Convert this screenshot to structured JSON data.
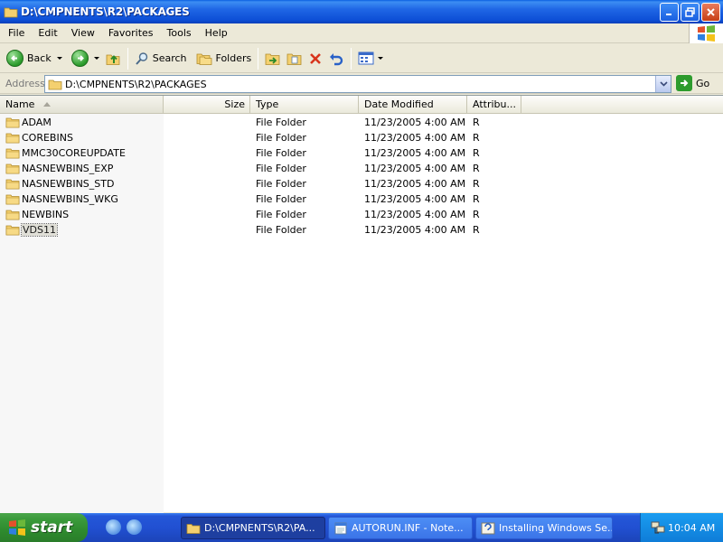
{
  "window": {
    "title": "D:\\CMPNENTS\\R2\\PACKAGES"
  },
  "menu": [
    {
      "label": "File"
    },
    {
      "label": "Edit"
    },
    {
      "label": "View"
    },
    {
      "label": "Favorites"
    },
    {
      "label": "Tools"
    },
    {
      "label": "Help"
    }
  ],
  "toolbar": {
    "back_label": "Back",
    "search_label": "Search",
    "folders_label": "Folders"
  },
  "address": {
    "label": "Address",
    "value": "D:\\CMPNENTS\\R2\\PACKAGES",
    "go_label": "Go"
  },
  "columns": {
    "name": "Name",
    "size": "Size",
    "type": "Type",
    "date": "Date Modified",
    "attrib": "Attribu..."
  },
  "files": [
    {
      "name": "ADAM",
      "size": "",
      "type": "File Folder",
      "date": "11/23/2005 4:00 AM",
      "attrib": "R"
    },
    {
      "name": "COREBINS",
      "size": "",
      "type": "File Folder",
      "date": "11/23/2005 4:00 AM",
      "attrib": "R"
    },
    {
      "name": "MMC30COREUPDATE",
      "size": "",
      "type": "File Folder",
      "date": "11/23/2005 4:00 AM",
      "attrib": "R"
    },
    {
      "name": "NASNEWBINS_EXP",
      "size": "",
      "type": "File Folder",
      "date": "11/23/2005 4:00 AM",
      "attrib": "R"
    },
    {
      "name": "NASNEWBINS_STD",
      "size": "",
      "type": "File Folder",
      "date": "11/23/2005 4:00 AM",
      "attrib": "R"
    },
    {
      "name": "NASNEWBINS_WKG",
      "size": "",
      "type": "File Folder",
      "date": "11/23/2005 4:00 AM",
      "attrib": "R"
    },
    {
      "name": "NEWBINS",
      "size": "",
      "type": "File Folder",
      "date": "11/23/2005 4:00 AM",
      "attrib": "R"
    },
    {
      "name": "VDS11",
      "size": "",
      "type": "File Folder",
      "date": "11/23/2005 4:00 AM",
      "attrib": "R",
      "selected": true
    }
  ],
  "taskbar": {
    "start_label": "start",
    "tasks": [
      {
        "label": "D:\\CMPNENTS\\R2\\PA...",
        "active": true
      },
      {
        "label": "AUTORUN.INF - Note...",
        "active": false
      },
      {
        "label": "Installing Windows Se...",
        "active": false
      }
    ],
    "clock": "10:04 AM"
  },
  "colors": {
    "titlebar": "#0d4fd6",
    "taskbar": "#2150d2",
    "start": "#2e8b2e",
    "folder": "#f4d06f"
  }
}
